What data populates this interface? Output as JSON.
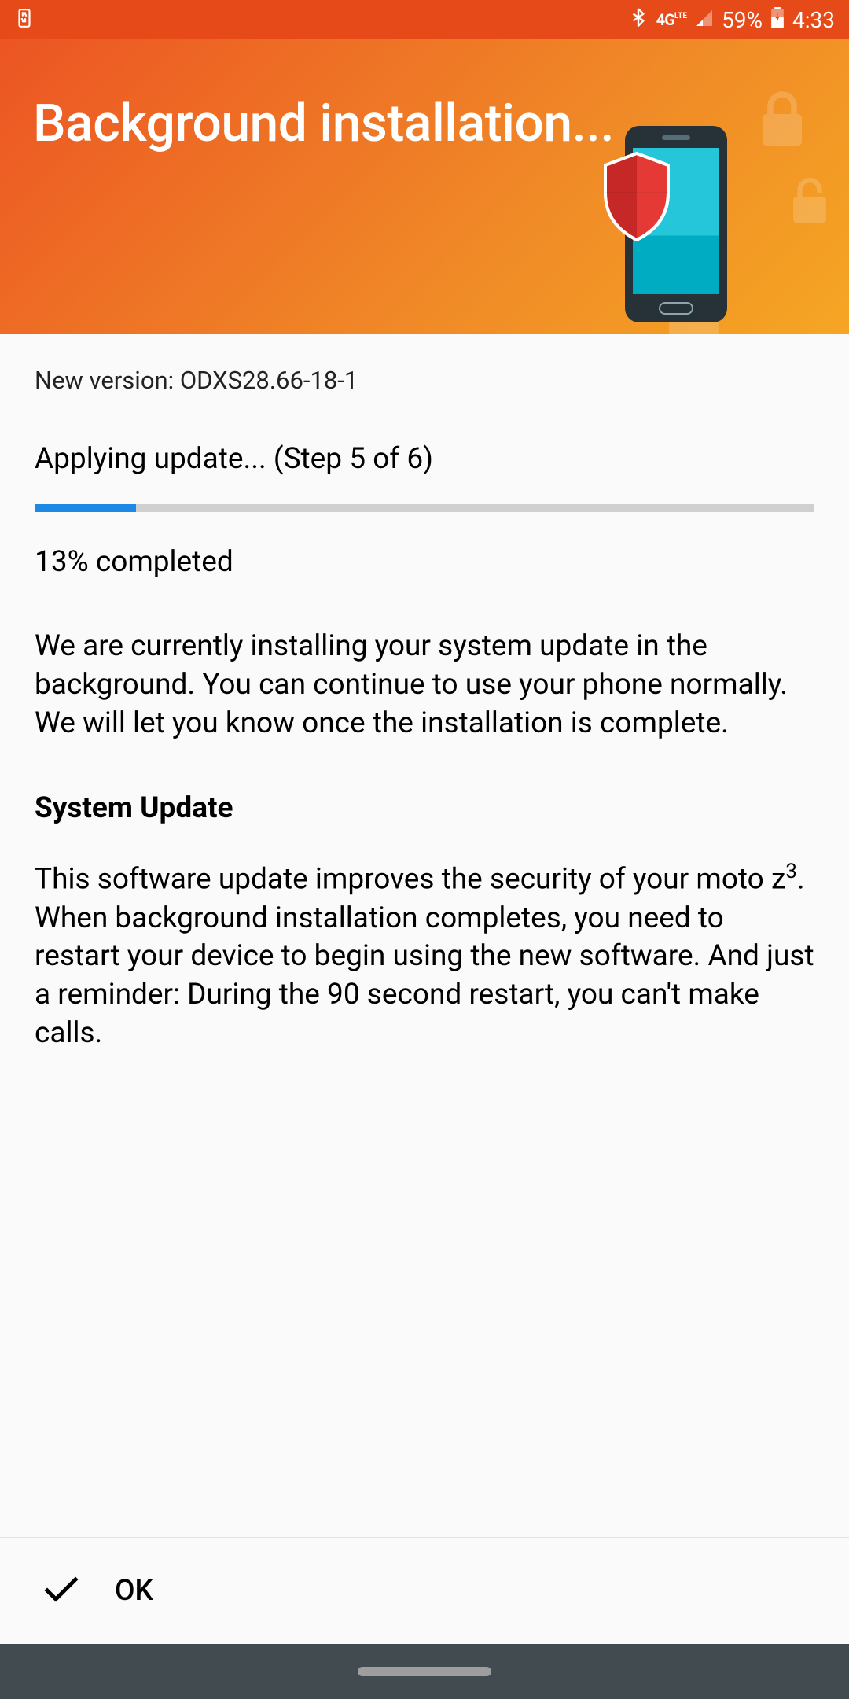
{
  "statusBar": {
    "networkType": "4G",
    "lte": "LTE",
    "battery": "59%",
    "time": "4:33"
  },
  "header": {
    "title": "Background installation..."
  },
  "content": {
    "versionLabel": "New version: ODXS28.66-18-1",
    "stepLabel": "Applying update... (Step 5 of 6)",
    "progressPercent": 13,
    "completedLabel": "13% completed",
    "description": "We are currently installing your system update in the background. You can continue to use your phone normally. We will let you know once the installation is complete.",
    "sectionHeading": "System Update",
    "detailsLine1Prefix": "This software update improves the security of your moto z",
    "detailsLine1Sup": "3",
    "detailsLine1Suffix": ".",
    "detailsLine2": "When background installation completes, you need to restart your device to begin using the new software. And just a reminder: During the 90 second restart, you can't make calls."
  },
  "bottomBar": {
    "okLabel": "OK"
  }
}
